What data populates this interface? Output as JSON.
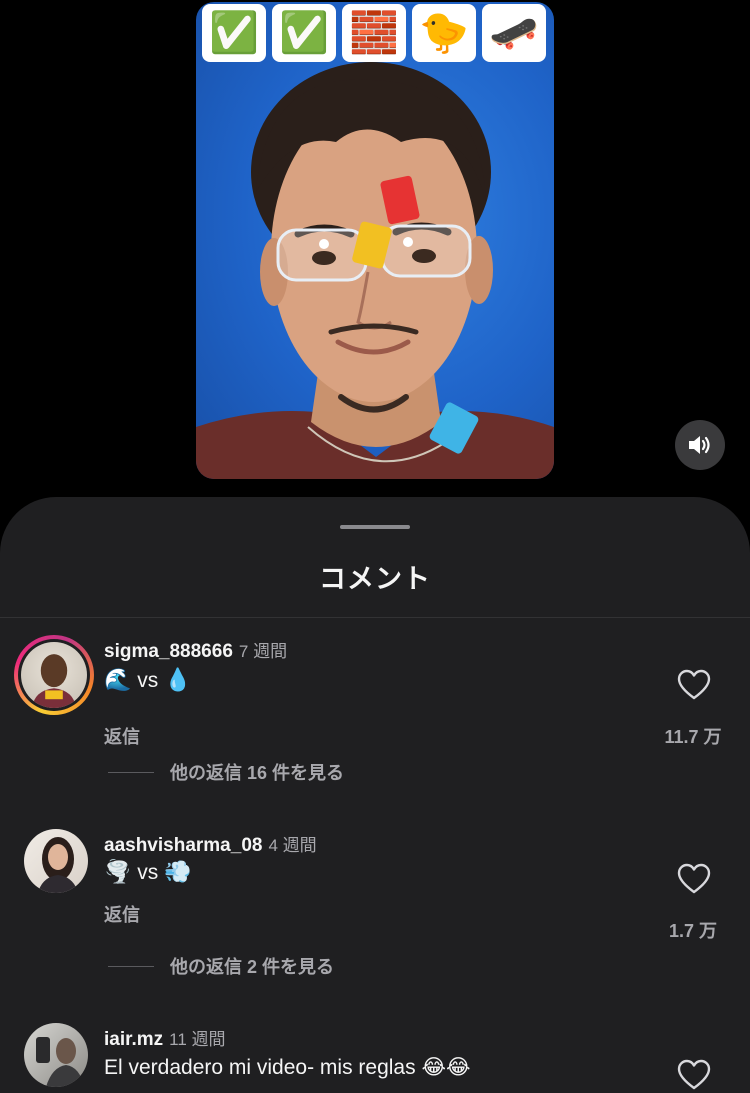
{
  "video": {
    "emoji_tiles": [
      "✅",
      "✅",
      "🧱",
      "🐤",
      "🛹"
    ]
  },
  "sheet": {
    "title": "コメント"
  },
  "comments": [
    {
      "username": "sigma_888666",
      "time": "7 週間",
      "text": "vs",
      "emoji_before": "🌊",
      "emoji_after": "💧",
      "reply_label": "返信",
      "likes": "11.7 万",
      "more_replies": "他の返信 16 件を見る",
      "has_story_ring": true
    },
    {
      "username": "aashvisharma_08",
      "time": "4 週間",
      "text": "vs",
      "emoji_before": "🌪️",
      "emoji_after": "💨",
      "reply_label": "返信",
      "likes": "1.7 万",
      "more_replies": "他の返信 2 件を見る",
      "has_story_ring": false
    },
    {
      "username": "iair.mz",
      "time": "11 週間",
      "text": "El verdadero mi video- mis reglas 😂😂",
      "has_story_ring": false
    }
  ],
  "icons": {
    "volume": "speaker-on-icon",
    "like": "heart-outline-icon"
  },
  "colors": {
    "sheet_background": "#1f1f21",
    "secondary_text": "#a8a8ad",
    "video_backdrop": "#1f63c8"
  }
}
